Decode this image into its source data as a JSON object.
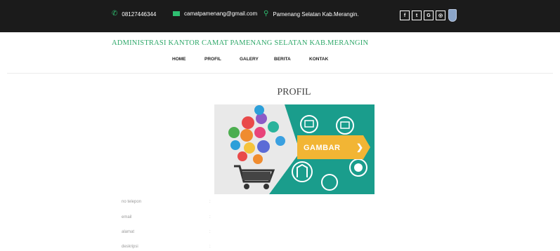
{
  "topbar": {
    "phone": "08127446344",
    "email": "camatpamenang@gmail.com",
    "address": "Pamenang Selatan Kab.Merangin.",
    "icons": [
      "phone-icon",
      "mail-icon",
      "location-pin-icon"
    ],
    "socials": [
      "f",
      "t",
      "G",
      "◎"
    ]
  },
  "brand": {
    "title": "ADMINISTRASI KANTOR CAMAT PAMENANG SELATAN KAB.MERANGIN"
  },
  "nav": {
    "items": [
      "HOME",
      "PROFIL",
      "GALERY",
      "BERITA",
      "KONTAK"
    ]
  },
  "page": {
    "title": "PROFIL"
  },
  "hero": {
    "button_text": "GAMBAR"
  },
  "info": {
    "labels": [
      "no telepon",
      "email",
      "alamat",
      "deskripsi"
    ],
    "colon": ":"
  },
  "colors": {
    "topbar_bg": "#1b1b1b",
    "accent_green": "#2fa86a",
    "hero_teal": "#1a9d8c",
    "hero_yellow": "#f2b534"
  }
}
